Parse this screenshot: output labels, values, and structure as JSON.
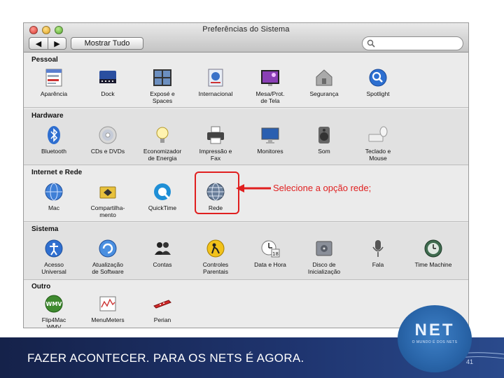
{
  "window": {
    "title": "Preferências do Sistema",
    "show_all": "Mostrar Tudo",
    "back": "◀",
    "forward": "▶"
  },
  "sections": [
    {
      "label": "Pessoal",
      "items": [
        {
          "label": "Aparência",
          "icon": "appearance-icon"
        },
        {
          "label": "Dock",
          "icon": "dock-icon"
        },
        {
          "label": "Exposé e\nSpaces",
          "icon": "expose-spaces-icon"
        },
        {
          "label": "Internacional",
          "icon": "international-icon"
        },
        {
          "label": "Mesa/Prot.\nde Tela",
          "icon": "desktop-screensaver-icon"
        },
        {
          "label": "Segurança",
          "icon": "security-icon"
        },
        {
          "label": "Spotlight",
          "icon": "spotlight-icon"
        }
      ]
    },
    {
      "label": "Hardware",
      "items": [
        {
          "label": "Bluetooth",
          "icon": "bluetooth-icon"
        },
        {
          "label": "CDs e DVDs",
          "icon": "cd-dvd-icon"
        },
        {
          "label": "Economizador\nde Energia",
          "icon": "energy-saver-icon"
        },
        {
          "label": "Impressão e\nFax",
          "icon": "print-fax-icon"
        },
        {
          "label": "Monitores",
          "icon": "displays-icon"
        },
        {
          "label": "Som",
          "icon": "sound-icon"
        },
        {
          "label": "Teclado e\nMouse",
          "icon": "keyboard-mouse-icon"
        }
      ]
    },
    {
      "label": "Internet e Rede",
      "items": [
        {
          "label": "Mac",
          "icon": "mac-icon"
        },
        {
          "label": "Compartilha-\nmento",
          "icon": "sharing-icon"
        },
        {
          "label": "QuickTime",
          "icon": "quicktime-icon"
        },
        {
          "label": "Rede",
          "icon": "network-icon"
        }
      ]
    },
    {
      "label": "Sistema",
      "items": [
        {
          "label": "Acesso\nUniversal",
          "icon": "universal-access-icon"
        },
        {
          "label": "Atualização\nde Software",
          "icon": "software-update-icon"
        },
        {
          "label": "Contas",
          "icon": "accounts-icon"
        },
        {
          "label": "Controles\nParentais",
          "icon": "parental-controls-icon"
        },
        {
          "label": "Data e Hora",
          "icon": "date-time-icon"
        },
        {
          "label": "Disco de\nInicialização",
          "icon": "startup-disk-icon"
        },
        {
          "label": "Fala",
          "icon": "speech-icon"
        },
        {
          "label": "Time Machine",
          "icon": "time-machine-icon"
        }
      ]
    },
    {
      "label": "Outro",
      "items": [
        {
          "label": "Flip4Mac\nWMV",
          "icon": "flip4mac-icon"
        },
        {
          "label": "MenuMeters",
          "icon": "menumeters-icon"
        },
        {
          "label": "Perian",
          "icon": "perian-icon"
        }
      ]
    }
  ],
  "annotation": {
    "text": "Selecione a opção rede;",
    "color": "#e02020"
  },
  "footer": {
    "text": "FAZER ACONTECER. PARA OS NETS É AGORA.",
    "page": "41"
  },
  "logo": {
    "word": "NET",
    "tagline": "O MUNDO É DOS NETS"
  },
  "colors": {
    "footer_bg": "#1f3570",
    "highlight": "#e01f1f"
  }
}
